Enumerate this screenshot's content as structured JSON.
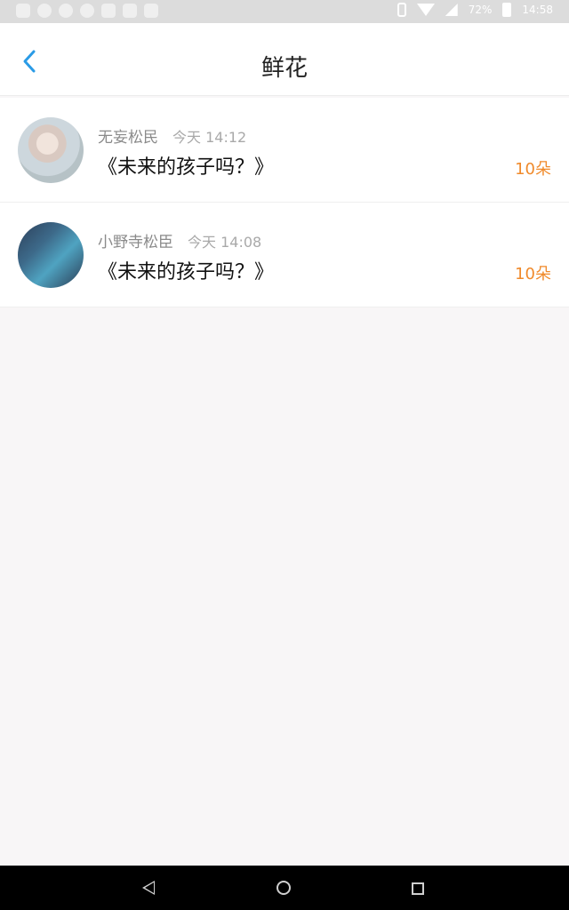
{
  "status": {
    "battery": "72%",
    "time": "14:58"
  },
  "header": {
    "title": "鲜花"
  },
  "items": [
    {
      "name": "无妄松民",
      "time": "今天 14:12",
      "title": "《未来的孩子吗？》",
      "count": "10朵"
    },
    {
      "name": "小野寺松臣",
      "time": "今天 14:08",
      "title": "《未来的孩子吗？》",
      "count": "10朵"
    }
  ],
  "colors": {
    "accent": "#2a9be6",
    "count": "#f08a2b"
  }
}
